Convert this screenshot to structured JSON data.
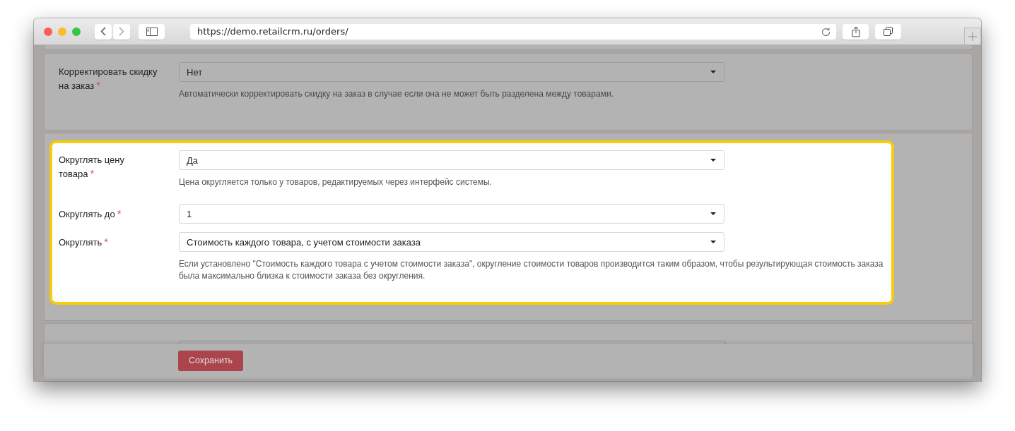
{
  "browser": {
    "url": "https://demo.retailcrm.ru/orders/"
  },
  "sections": [
    {
      "highlighted": false,
      "fields": [
        {
          "label": "Корректировать скидку на заказ",
          "required_mark": "*",
          "value": "Нет",
          "help": "Автоматически корректировать скидку на заказ в случае если она не может быть разделена между товарами."
        }
      ]
    },
    {
      "highlighted": true,
      "fields": [
        {
          "label": "Округлять цену товара",
          "required_mark": "*",
          "value": "Да",
          "help": "Цена округляется только у товаров, редактируемых через интерфейс системы."
        },
        {
          "label": "Округлять до",
          "required_mark": "*",
          "value": "1"
        },
        {
          "label": "Округлять",
          "required_mark": "*",
          "value": "Стоимость каждого товара, с учетом стоимости заказа",
          "help": "Если установлено \"Стоимость каждого товара с учетом стоимости заказа\", округление стоимости товаров производится таким образом, чтобы результирующая стоимость заказа была максимально близка к стоимости заказа без округления."
        }
      ]
    }
  ],
  "save_button": {
    "label": "Сохранить"
  }
}
